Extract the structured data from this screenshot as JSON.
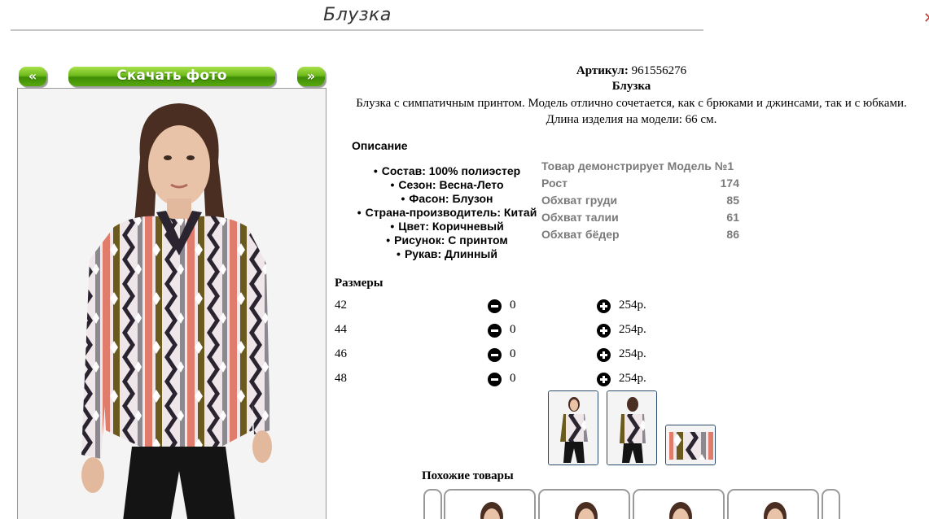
{
  "page": {
    "title": "Блузка",
    "corner_mark": "✕"
  },
  "nav": {
    "prev_label": "«",
    "download_label": "Скачать фото",
    "next_label": "»"
  },
  "product": {
    "article_label": "Артикул:",
    "article_value": "961556276",
    "name": "Блузка",
    "description_line1": "Блузка с симпатичным принтом. Модель отлично сочетается, как с брюками и джинсами, так и с юбками.",
    "description_line2": "Длина изделия на модели: 66 см."
  },
  "description": {
    "heading": "Описание",
    "specs": [
      "Состав: 100% полиэстер",
      "Сезон: Весна-Лето",
      "Фасон: Блузон",
      "Страна-производитель: Китай",
      "Цвет: Коричневый",
      "Рисунок: С принтом",
      "Рукав: Длинный"
    ]
  },
  "model": {
    "title": "Товар демонстрирует Модель №1",
    "rows": [
      {
        "label": "Рост",
        "value": "174"
      },
      {
        "label": "Обхват груди",
        "value": "85"
      },
      {
        "label": "Обхват талии",
        "value": "61"
      },
      {
        "label": "Обхват бёдер",
        "value": "86"
      }
    ]
  },
  "sizes": {
    "heading": "Размеры",
    "rows": [
      {
        "size": "42",
        "qty": "0",
        "price": "254р."
      },
      {
        "size": "44",
        "qty": "0",
        "price": "254р."
      },
      {
        "size": "46",
        "qty": "0",
        "price": "254р."
      },
      {
        "size": "48",
        "qty": "0",
        "price": "254р."
      }
    ]
  },
  "similar": {
    "heading": "Похожие товары"
  },
  "colors": {
    "button_green": "#58a80f",
    "thumb_border": "#2b4a6b",
    "model_text": "#7a7a7a",
    "print_pink": "#e07c6c",
    "print_olive": "#6b5a1e",
    "print_dark": "#2a2430"
  },
  "icons": {
    "minus": "minus-circle-icon",
    "plus": "plus-circle-icon"
  }
}
